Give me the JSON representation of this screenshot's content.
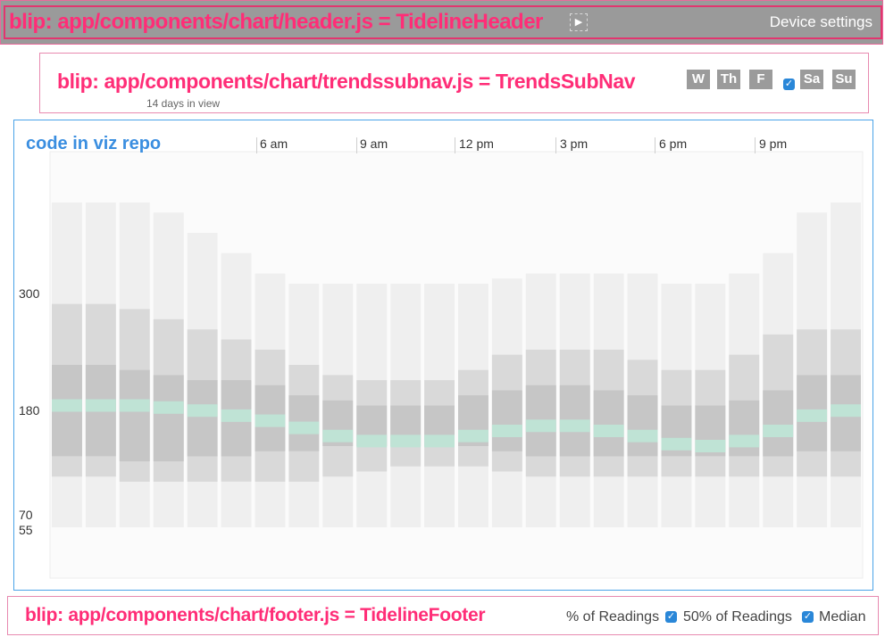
{
  "header": {
    "annotation": "blip: app/components/chart/header.js = TidelineHeader",
    "device_settings_label": "Device settings"
  },
  "subnav": {
    "annotation": "blip: app/components/chart/trendssubnav.js = TrendsSubNav",
    "days_in_view": "14 days in view",
    "days": [
      {
        "label": "W",
        "checked": false
      },
      {
        "label": "Th",
        "checked": false
      },
      {
        "label": "F",
        "checked": false
      },
      {
        "label": "Sa",
        "checked": true
      },
      {
        "label": "Su",
        "checked": false
      }
    ]
  },
  "viz": {
    "annotation": "code in viz repo"
  },
  "footer": {
    "annotation": "blip: app/components/chart/footer.js = TidelineFooter",
    "partial_label": "% of Readings",
    "options": [
      {
        "label": "50% of Readings",
        "checked": true
      },
      {
        "label": "Median",
        "checked": true
      }
    ]
  },
  "colors": {
    "header_bg": "#9a9a9a",
    "annotation_pink": "#ff2d77",
    "annotation_blue": "#3a8ee0",
    "checkbox_blue": "#2a87d8",
    "band_outer": "#efefef",
    "band_mid": "#d9d9d9",
    "band_inner": "#c6c6c6",
    "median": "#bfe3d5"
  },
  "chart_data": {
    "type": "area",
    "xlabel": "",
    "ylabel": "",
    "x_ticks": [
      "6 am",
      "9 am",
      "12 pm",
      "3 pm",
      "6 pm",
      "9 pm"
    ],
    "y_ticks": [
      300,
      180,
      70,
      55
    ],
    "x": [
      0,
      1,
      2,
      3,
      4,
      5,
      6,
      7,
      8,
      9,
      10,
      11,
      12,
      13,
      14,
      15,
      16,
      17,
      18,
      19,
      20,
      21,
      22,
      23
    ],
    "series": [
      {
        "values": [
          370,
          370,
          370,
          360,
          340,
          320,
          300,
          290,
          290,
          290,
          290,
          290,
          290,
          295,
          300,
          300,
          300,
          300,
          290,
          290,
          300,
          320,
          360,
          370
        ]
      },
      {
        "values": [
          50,
          50,
          50,
          50,
          50,
          50,
          50,
          50,
          50,
          50,
          50,
          50,
          50,
          50,
          50,
          50,
          50,
          50,
          50,
          50,
          50,
          50,
          50,
          50
        ]
      },
      {
        "values": [
          270,
          270,
          265,
          255,
          245,
          235,
          225,
          210,
          200,
          195,
          195,
          195,
          205,
          220,
          225,
          225,
          225,
          215,
          205,
          205,
          220,
          240,
          245,
          245
        ]
      },
      {
        "values": [
          100,
          100,
          95,
          95,
          95,
          95,
          95,
          95,
          100,
          105,
          110,
          110,
          110,
          105,
          100,
          100,
          100,
          100,
          100,
          100,
          100,
          100,
          100,
          100
        ]
      },
      {
        "values": [
          210,
          210,
          205,
          200,
          195,
          195,
          190,
          180,
          175,
          170,
          170,
          170,
          180,
          185,
          190,
          190,
          185,
          180,
          170,
          170,
          175,
          185,
          200,
          200
        ]
      },
      {
        "values": [
          120,
          120,
          115,
          115,
          120,
          120,
          125,
          125,
          130,
          130,
          130,
          130,
          130,
          125,
          120,
          120,
          120,
          120,
          120,
          120,
          120,
          120,
          125,
          125
        ]
      },
      {
        "values": [
          170,
          170,
          170,
          168,
          165,
          160,
          155,
          148,
          140,
          135,
          135,
          135,
          140,
          145,
          150,
          150,
          145,
          140,
          132,
          130,
          135,
          145,
          160,
          165
        ]
      }
    ],
    "ylim": [
      0,
      420
    ]
  }
}
